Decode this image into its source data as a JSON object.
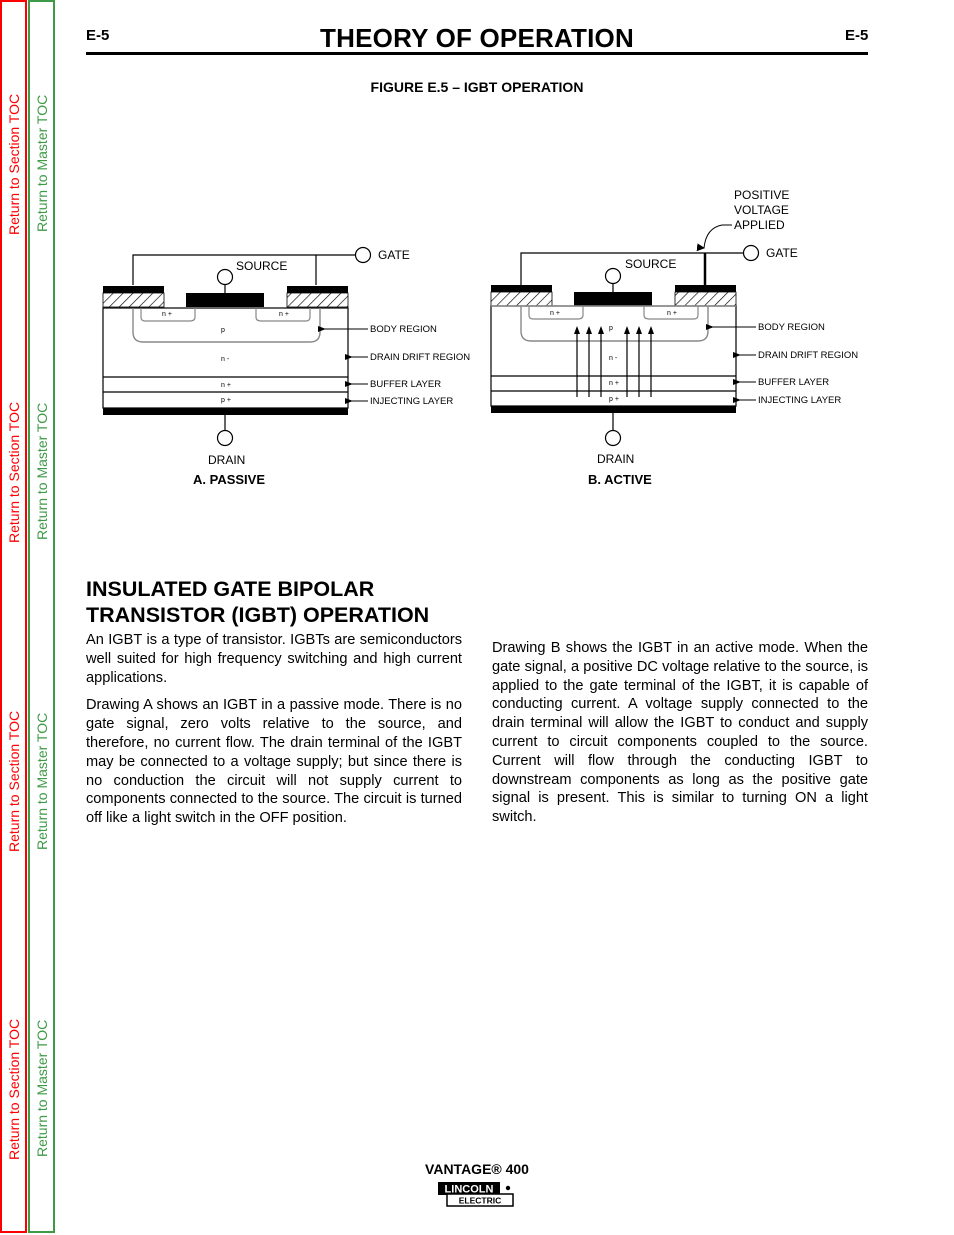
{
  "toc": {
    "section_label": "Return to Section TOC",
    "master_label": "Return to Master TOC",
    "section_color": "#ff0000",
    "master_color": "#3f9a47"
  },
  "header": {
    "page_code_left": "E-5",
    "title": "THEORY OF OPERATION",
    "page_code_right": "E-5"
  },
  "figure": {
    "caption": "FIGURE E.5 – IGBT OPERATION",
    "passive": {
      "label": "A. PASSIVE",
      "source": "SOURCE",
      "gate": "GATE",
      "drain": "DRAIN",
      "region_labels": [
        "BODY REGION",
        "DRAIN DRIFT REGION",
        "BUFFER LAYER",
        "INJECTING LAYER"
      ],
      "doping": {
        "n_plus_left": "n +",
        "n_plus_right": "n +",
        "p": "p",
        "n_minus": "n -",
        "buffer": "n +",
        "inject": "p +"
      }
    },
    "active": {
      "label": "B. ACTIVE",
      "source": "SOURCE",
      "gate": "GATE",
      "drain": "DRAIN",
      "annotation": [
        "POSITIVE",
        "VOLTAGE",
        "APPLIED"
      ],
      "region_labels": [
        "BODY REGION",
        "DRAIN DRIFT REGION",
        "BUFFER LAYER",
        "INJECTING LAYER"
      ],
      "doping": {
        "n_plus_left": "n +",
        "n_plus_right": "n +",
        "p": "p",
        "n_minus": "n -",
        "buffer": "n +",
        "inject": "p +"
      },
      "current_arrows": 6
    }
  },
  "section": {
    "title_line1": "INSULATED GATE BIPOLAR",
    "title_line2": "TRANSISTOR (IGBT) OPERATION",
    "left_paragraphs": [
      "An IGBT is a type of transistor.  IGBTs are semiconductors well suited for high frequency switching and high current applications.",
      "Drawing A shows an IGBT in a passive mode.  There is no gate signal, zero volts relative to the source, and therefore, no current flow.  The drain terminal of the IGBT may be connected to a voltage supply; but since there is no conduction the circuit will not supply current to components connected to the source.  The circuit is turned off like a light switch in the OFF position."
    ],
    "right_paragraphs": [
      "Drawing B shows the IGBT in an active mode.  When the gate signal, a positive DC voltage relative to the source, is applied to the gate terminal of the IGBT, it is capable of conducting current. A voltage supply connected to the drain terminal will allow the IGBT to conduct and supply current to circuit components coupled to the source.  Current will flow through the conducting IGBT to downstream components as long as the positive gate signal is present.  This is similar to turning ON a light switch."
    ]
  },
  "footer": {
    "model": "VANTAGE® 400",
    "logo_top": "LINCOLN",
    "logo_bottom": "ELECTRIC"
  }
}
